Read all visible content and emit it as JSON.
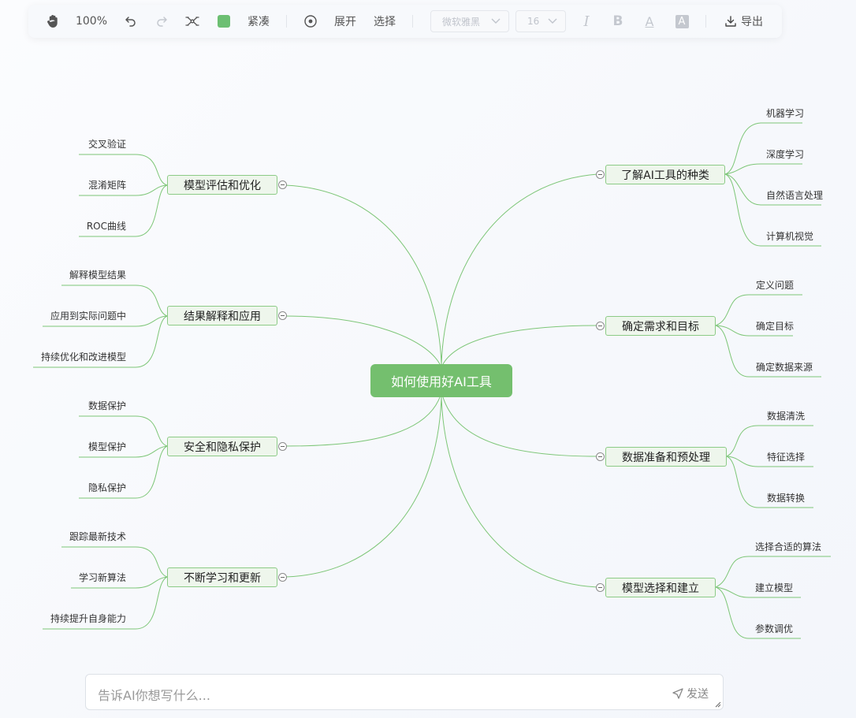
{
  "toolbar": {
    "hand_icon": "hand-icon",
    "zoom": "100%",
    "undo_icon": "undo-icon",
    "redo_icon": "redo-icon",
    "layout_icon": "structure-icon",
    "node_color": "#6cbf72",
    "compact_label": "紧凑",
    "center_icon": "target-icon",
    "expand_label": "展开",
    "select_label": "选择",
    "font_family_value": "微软雅黑",
    "font_size_value": "16",
    "italic_label": "I",
    "bold_label": "B",
    "font_color_label": "A",
    "bg_color_label": "A",
    "export_label": "导出"
  },
  "mindmap": {
    "root": "如何使用好AI工具",
    "branches": [
      {
        "label": "了解AI工具的种类",
        "children": [
          "机器学习",
          "深度学习",
          "自然语言处理",
          "计算机视觉"
        ]
      },
      {
        "label": "确定需求和目标",
        "children": [
          "定义问题",
          "确定目标",
          "确定数据来源"
        ]
      },
      {
        "label": "数据准备和预处理",
        "children": [
          "数据清洗",
          "特征选择",
          "数据转换"
        ]
      },
      {
        "label": "模型选择和建立",
        "children": [
          "选择合适的算法",
          "建立模型",
          "参数调优"
        ]
      },
      {
        "label": "模型评估和优化",
        "children": [
          "交叉验证",
          "混淆矩阵",
          "ROC曲线"
        ]
      },
      {
        "label": "结果解释和应用",
        "children": [
          "解释模型结果",
          "应用到实际问题中",
          "持续优化和改进模型"
        ]
      },
      {
        "label": "安全和隐私保护",
        "children": [
          "数据保护",
          "模型保护",
          "隐私保护"
        ]
      },
      {
        "label": "不断学习和更新",
        "children": [
          "跟踪最新技术",
          "学习新算法",
          "持续提升自身能力"
        ]
      }
    ]
  },
  "colors": {
    "root_fill": "#74bf6e",
    "branch_fill": "#eef6ec",
    "branch_border": "#8ccb86",
    "line": "#7dc677"
  },
  "input": {
    "placeholder": "告诉AI你想写什么...",
    "value": "",
    "send_label": "发送"
  }
}
